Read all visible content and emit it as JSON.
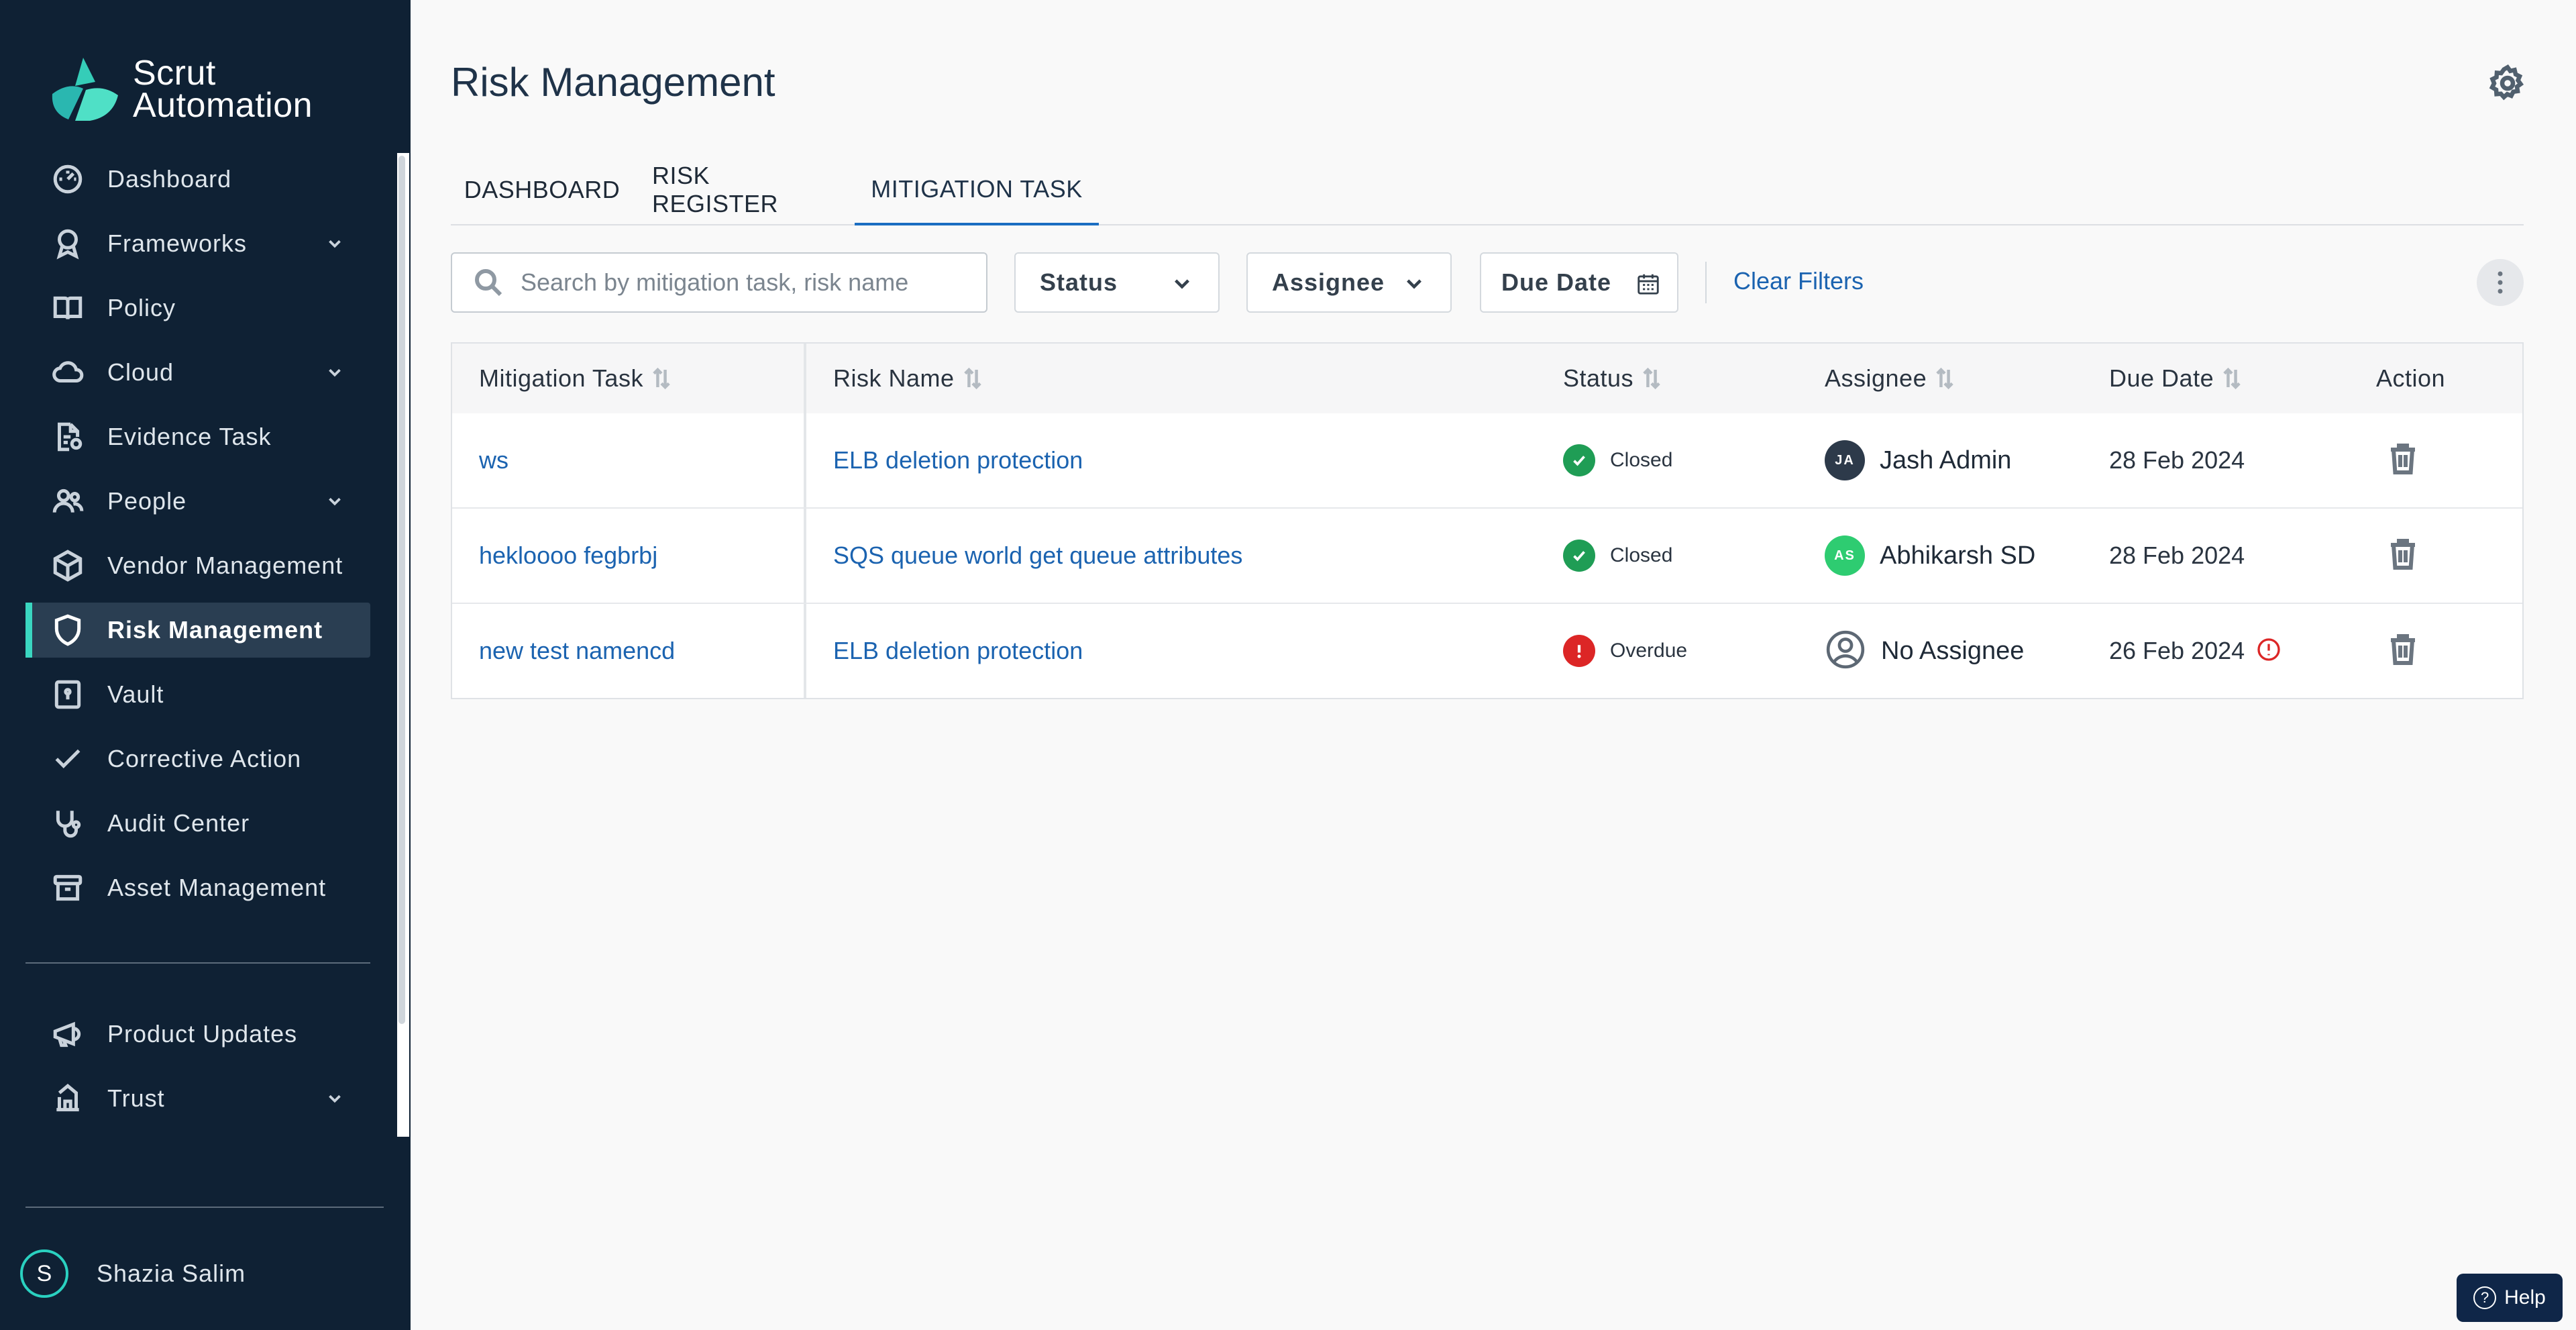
{
  "app": {
    "brand_line1": "Scrut",
    "brand_line2": "Automation"
  },
  "sidebar": {
    "items": [
      {
        "label": "Dashboard",
        "icon": "dashboard-icon",
        "has_chevron": false
      },
      {
        "label": "Frameworks",
        "icon": "badge-icon",
        "has_chevron": true
      },
      {
        "label": "Policy",
        "icon": "book-icon",
        "has_chevron": false
      },
      {
        "label": "Cloud",
        "icon": "cloud-icon",
        "has_chevron": true
      },
      {
        "label": "Evidence Task",
        "icon": "evidence-icon",
        "has_chevron": false
      },
      {
        "label": "People",
        "icon": "people-icon",
        "has_chevron": true
      },
      {
        "label": "Vendor Management",
        "icon": "cube-icon",
        "has_chevron": false
      },
      {
        "label": "Risk Management",
        "icon": "shield-icon",
        "has_chevron": false,
        "active": true
      },
      {
        "label": "Vault",
        "icon": "vault-icon",
        "has_chevron": false
      },
      {
        "label": "Corrective Action",
        "icon": "check-icon",
        "has_chevron": false
      },
      {
        "label": "Audit Center",
        "icon": "stethoscope-icon",
        "has_chevron": false
      },
      {
        "label": "Asset Management",
        "icon": "archive-icon",
        "has_chevron": false
      }
    ],
    "secondary_items": [
      {
        "label": "Product Updates",
        "icon": "megaphone-icon",
        "has_chevron": false
      },
      {
        "label": "Trust",
        "icon": "trust-icon",
        "has_chevron": true
      }
    ],
    "user": {
      "initial": "S",
      "name": "Shazia Salim"
    },
    "accent_color": "#3ad6c0"
  },
  "header": {
    "title": "Risk Management"
  },
  "tabs": [
    {
      "label": "DASHBOARD"
    },
    {
      "label": "RISK REGISTER"
    },
    {
      "label": "MITIGATION TASK",
      "active": true
    }
  ],
  "filters": {
    "search_placeholder": "Search by mitigation task, risk name",
    "status_label": "Status",
    "assignee_label": "Assignee",
    "due_date_label": "Due Date",
    "clear_label": "Clear Filters"
  },
  "table": {
    "columns": [
      "Mitigation Task",
      "Risk Name",
      "Status",
      "Assignee",
      "Due Date",
      "Action"
    ],
    "rows": [
      {
        "task": "ws",
        "risk": "ELB deletion protection",
        "status": "Closed",
        "status_color": "#1f9d55",
        "assignee": "Jash Admin",
        "assignee_initials": "JA",
        "avatar_color": "#2d3a4a",
        "due": "28 Feb 2024",
        "overdue": false
      },
      {
        "task": "hekloooo fegbrbj",
        "risk": "SQS queue world get queue attributes",
        "status": "Closed",
        "status_color": "#1f9d55",
        "assignee": "Abhikarsh SD",
        "assignee_initials": "AS",
        "avatar_color": "#2ecc71",
        "due": "28 Feb 2024",
        "overdue": false
      },
      {
        "task": "new test namencd",
        "risk": "ELB deletion protection",
        "status": "Overdue",
        "status_color": "#dc2626",
        "assignee": "No Assignee",
        "assignee_initials": "",
        "avatar_color": "",
        "due": "26 Feb 2024",
        "overdue": true
      }
    ]
  },
  "help": {
    "label": "Help"
  }
}
